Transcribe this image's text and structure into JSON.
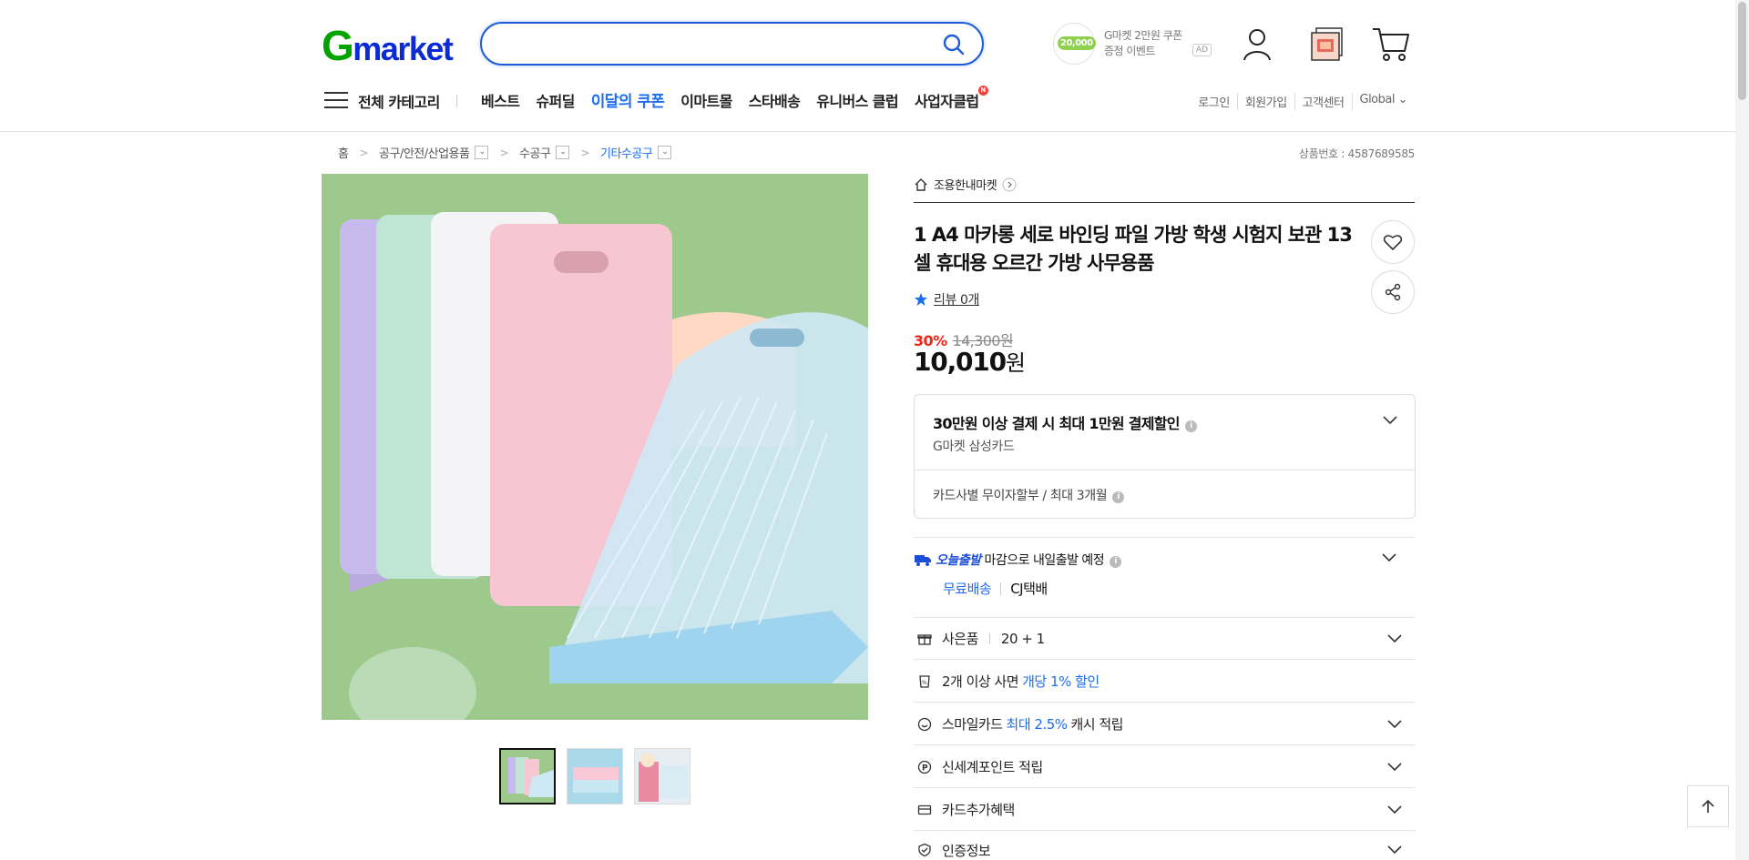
{
  "header": {
    "logo_g": "G",
    "logo_rest": "market",
    "search_placeholder": "",
    "promo_coin": "20,000",
    "promo_line1": "G마켓 2만원 쿠폰",
    "promo_line2": "증정 이벤트",
    "ad_label": "AD"
  },
  "nav": {
    "all_categories": "전체 카테고리",
    "links": [
      "베스트",
      "슈퍼딜",
      "이달의 쿠폰",
      "이마트몰",
      "스타배송",
      "유니버스 클럽",
      "사업자클럽"
    ],
    "new_badge": "N",
    "util": [
      "로그인",
      "회원가입",
      "고객센터",
      "Global ⌄"
    ]
  },
  "breadcrumb": {
    "home": "홈",
    "items": [
      "공구/안전/산업용품",
      "수공구",
      "기타수공구"
    ]
  },
  "product_number": "상품번호 : 4587689585",
  "seller": "조용한내마켓",
  "product": {
    "title": "1 A4 마카롱 세로 바인딩 파일 가방 학생 시험지 보관 13 셀 휴대용 오르간 가방 사무용품",
    "review": "리뷰 0개",
    "discount_rate": "30%",
    "original_price": "14,300원",
    "price": "10,010",
    "price_unit": "원"
  },
  "card_benefit": {
    "headline": "30만원 이상 결제 시 최대 1만원 결제할인",
    "card": "G마켓 삼성카드",
    "installment": "카드사별 무이자할부 / 최대 3개월"
  },
  "shipping": {
    "today": "오늘출발",
    "note": "마감으로 내일출발 예정",
    "free": "무료배송",
    "carrier": "CJ택배"
  },
  "rows": {
    "gift_label": "사은품",
    "gift_value": "20 + 1",
    "multi_pre": "2개 이상 사면",
    "multi_hl": "개당 1% 할인",
    "smile_pre": "스마일카드",
    "smile_hl": "최대 2.5%",
    "smile_post": "캐시 적립",
    "shinsegae": "신세계포인트 적립",
    "card_extra": "카드추가혜택",
    "cert": "인증정보"
  },
  "colors": {
    "brand_green": "#00a300",
    "brand_blue": "#0b2bd6",
    "accent": "#1d6df1",
    "sale_red": "#f0261a"
  }
}
